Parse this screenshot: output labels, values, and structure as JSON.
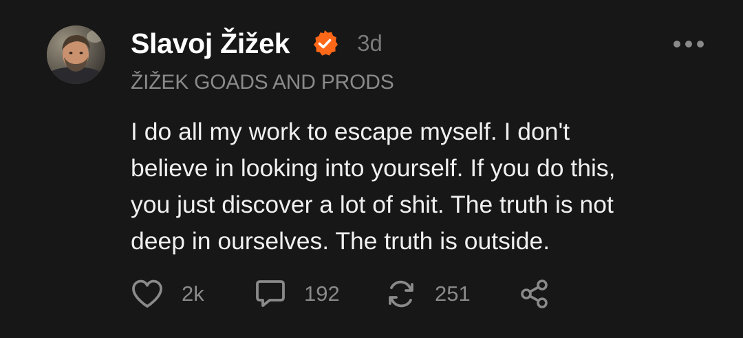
{
  "note": {
    "author": {
      "name": "Slavoj Žižek",
      "verified_color": "#FF6719",
      "avatar_icon": "author-photo"
    },
    "timestamp": "3d",
    "publication": "ŽIŽEK GOADS AND PRODS",
    "more_icon": "more-horizontal-icon",
    "body_lines": [
      "I do all my work to escape myself. I don't",
      "believe in looking into yourself. If you do this,",
      "you just discover a lot of shit. The truth is not",
      "deep in ourselves. The truth is outside."
    ],
    "actions": {
      "like": {
        "icon": "heart-icon",
        "count": "2k"
      },
      "comment": {
        "icon": "comment-icon",
        "count": "192"
      },
      "restack": {
        "icon": "restack-icon",
        "count": "251"
      },
      "share": {
        "icon": "share-icon"
      }
    }
  },
  "colors": {
    "background": "#171717",
    "text_primary": "#FFFFFF",
    "text_secondary": "#8A8A8A",
    "icon": "#8A8A8A",
    "accent": "#FF6719"
  }
}
